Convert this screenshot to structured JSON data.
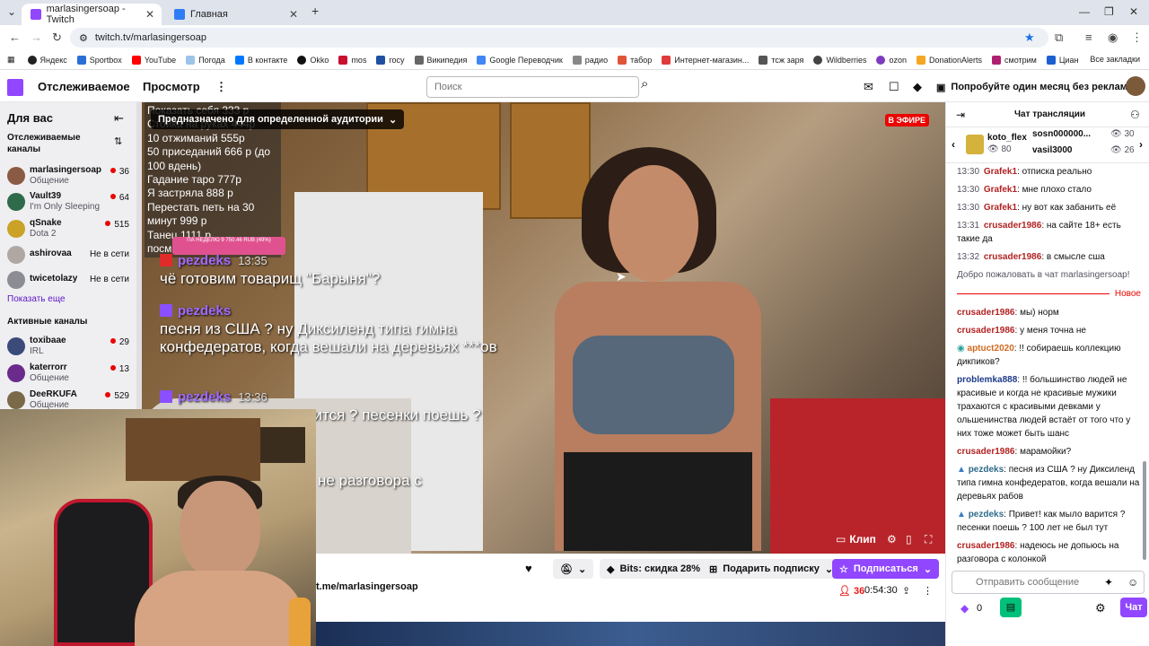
{
  "browser": {
    "tabs": [
      {
        "title": "marlasingersoap - Twitch",
        "icon_color": "#9147ff"
      },
      {
        "title": "Главная",
        "icon_color": "#2f7df6"
      }
    ],
    "url": "twitch.tv/marlasingersoap",
    "bookmarks": [
      "Яндекс",
      "Sportbox",
      "YouTube",
      "Погода",
      "В контакте",
      "Okko",
      "mos",
      "госу",
      "Википедия",
      "Google Переводчик",
      "радио",
      "табор",
      "Интернет-магазин...",
      "тсж заря",
      "Wildberries",
      "ozon",
      "DonationAlerts",
      "смотрим",
      "Циан"
    ],
    "bookmarks_all": "Все закладки"
  },
  "topnav": {
    "following": "Отслеживаемое",
    "browse": "Просмотр",
    "search_placeholder": "Поиск",
    "promo": "Попробуйте один месяц без рекламы"
  },
  "sidebar": {
    "title": "Для вас",
    "followed_header": "Отслеживаемые каналы",
    "followed": [
      {
        "name": "marlasingersoap",
        "game": "Общение",
        "viewers": "36",
        "color": "#8a5a44"
      },
      {
        "name": "Vault39",
        "game": "I'm Only Sleeping",
        "viewers": "64",
        "color": "#2e6b4a"
      },
      {
        "name": "qSnake",
        "game": "Dota 2",
        "viewers": "515",
        "color": "#c9a227"
      },
      {
        "name": "ashirovaa",
        "status": "Не в сети",
        "color": "#b0a7a2"
      },
      {
        "name": "twicetolazy",
        "status": "Не в сети",
        "color": "#8c8c94"
      }
    ],
    "show_more": "Показать еще",
    "active_header": "Активные каналы",
    "active": [
      {
        "name": "toxibaae",
        "game": "IRL",
        "viewers": "29",
        "color": "#3c4a7a"
      },
      {
        "name": "katerrorr",
        "game": "Общение",
        "viewers": "13",
        "color": "#6a2b8c"
      },
      {
        "name": "DeeRKUFA",
        "game": "Общение",
        "viewers": "529",
        "color": "#7a6a4a"
      }
    ]
  },
  "video": {
    "audience_label": "Предназначено для определенной аудитории",
    "live_label": "В ЭФИРЕ",
    "overlay_list": [
      "Показать себя 333 р",
      "Стойка на руках 444р",
      "10 отжиманий 555р",
      "50 приседаний 666 р (до 100 вдень)",
      "Гадание таро 777р",
      "Я застряла 888 р",
      "Перестать петь на 30 минут 999 р",
      "Танец 1111 р.",
      "посм..."
    ],
    "donation_bar": "ПА НЕДЕЛЮ 9 750.46 RUB (49%)",
    "overlay_chat": [
      {
        "user": "pezdeks",
        "time": "13:35",
        "text": "чё готовим товарищ \"Барыня\"?",
        "color": "#e02b2b"
      },
      {
        "user": "pezdeks",
        "time": "",
        "text": "песня из США ? ну Диксиленд типа гимна конфедератов, когда вешали на деревьях ***ов",
        "color": "#8a4fff"
      },
      {
        "user": "pezdeks",
        "time": "13:36",
        "text": "Привет! как мыло варится ? песенки поешь ? 100 лет не был тут",
        "color": "#8a4fff"
      }
    ],
    "overlay_chat_tail": "не разговора с",
    "clip_label": "Клип"
  },
  "info": {
    "bits_label": "Bits: скидка 28%",
    "gift_label": "Подарить подписку",
    "subscribe_label": "Подписаться",
    "telegram": "t.me/marlasingersoap",
    "viewers": "36",
    "uptime": "0:54:30"
  },
  "chat": {
    "title": "Чат трансляции",
    "leaders": [
      {
        "name": "koto_flex",
        "count": "80"
      },
      {
        "name": "sosn000000...",
        "count": "30"
      },
      {
        "name": "vasil3000",
        "count": "26"
      }
    ],
    "messages": [
      {
        "time": "13:30",
        "user": "Grafek1",
        "color": "#b22222",
        "text": "отписка реально"
      },
      {
        "time": "13:30",
        "user": "Grafek1",
        "color": "#b22222",
        "text": "мне плохо стало"
      },
      {
        "time": "13:30",
        "user": "Grafek1",
        "color": "#b22222",
        "text": "ну вот как забанить её"
      },
      {
        "time": "13:31",
        "user": "crusader1986",
        "color": "#b22222",
        "text": "на сайте 18+ есть такие да"
      },
      {
        "time": "13:32",
        "user": "crusader1986",
        "color": "#b22222",
        "text": "в смысле сша"
      }
    ],
    "welcome": "Добро пожаловать в чат marlasingersoap!",
    "new_label": "Новое",
    "messages_after": [
      {
        "user": "crusader1986",
        "color": "#b22222",
        "text": "мы) норм"
      },
      {
        "user": "crusader1986",
        "color": "#b22222",
        "text": "у меня точна не"
      },
      {
        "user": "aptuct2020",
        "color": "#d2691e",
        "text": "!! собираешь коллекцию дикпиков?"
      },
      {
        "user": "problemka888",
        "color": "#1e3a8a",
        "text": "!! большинство людей не красивые и когда не красивые мужики трахаются с красивыми девками у ольшенинства людей встаёт от того что у них тоже может быть шанс"
      },
      {
        "user": "crusader1986",
        "color": "#b22222",
        "text": "марамойки?"
      },
      {
        "user": "pezdeks",
        "color": "#2e6b8a",
        "text": "песня из США ? ну Диксиленд типа гимна конфедератов, когда вешали на деревьях рабов"
      },
      {
        "user": "pezdeks",
        "color": "#2e6b8a",
        "text": "Привет! как мыло варится ? песенки поешь ? 100 лет не был тут"
      },
      {
        "user": "crusader1986",
        "color": "#b22222",
        "text": "надеюсь не допьюсь на разговора с колонкой"
      }
    ],
    "input_placeholder": "Отправить сообщение",
    "points": "0",
    "send_label": "Чат"
  }
}
